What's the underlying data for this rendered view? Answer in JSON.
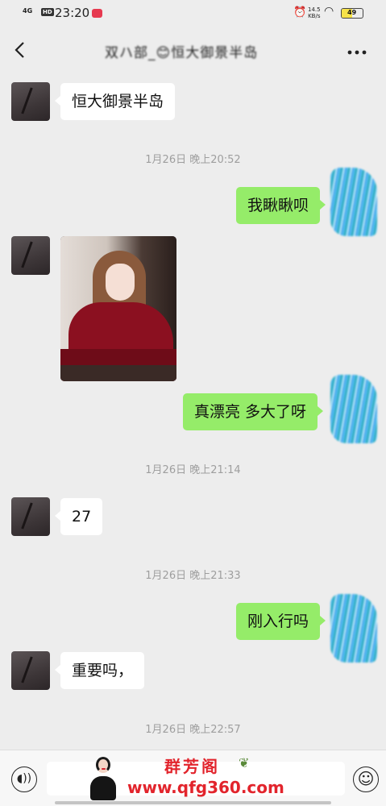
{
  "status_bar": {
    "network": "4G",
    "hd_badge": "HD",
    "time": "23:20",
    "alarm_icon": "alarm-icon",
    "speed_value": "14.5",
    "speed_unit": "KB/s",
    "wifi_icon": "wifi-icon",
    "battery_level": "49"
  },
  "header": {
    "back_icon": "chevron-left-icon",
    "title": "双ハ部_😊恒大御景半岛",
    "more_icon": "more-icon"
  },
  "messages": [
    {
      "type": "text",
      "direction": "in",
      "text": "恒大御景半岛"
    },
    {
      "type": "timestamp",
      "text": "1月26日 晚上20:52"
    },
    {
      "type": "text",
      "direction": "out",
      "text": "我瞅瞅呗"
    },
    {
      "type": "image",
      "direction": "in",
      "description_icon": "photo-icon"
    },
    {
      "type": "text",
      "direction": "out",
      "text": "真漂亮 多大了呀"
    },
    {
      "type": "timestamp",
      "text": "1月26日 晚上21:14"
    },
    {
      "type": "text",
      "direction": "in",
      "text": "27"
    },
    {
      "type": "timestamp",
      "text": "1月26日 晚上21:33"
    },
    {
      "type": "text",
      "direction": "out",
      "text": "刚入行吗"
    },
    {
      "type": "text",
      "direction": "in",
      "text": "重要吗，"
    },
    {
      "type": "timestamp",
      "text": "1月26日 晚上22:57"
    }
  ],
  "input_bar": {
    "voice_icon": "voice-icon",
    "input_value": "",
    "emoji_icon": "emoji-icon"
  },
  "watermark": {
    "name": "群芳阁",
    "url": "www.qfg360.com"
  },
  "colors": {
    "background": "#ededed",
    "incoming_bubble": "#ffffff",
    "outgoing_bubble": "#95ec69",
    "timestamp_text": "#9e9e9e",
    "watermark_red": "#e2242c"
  }
}
